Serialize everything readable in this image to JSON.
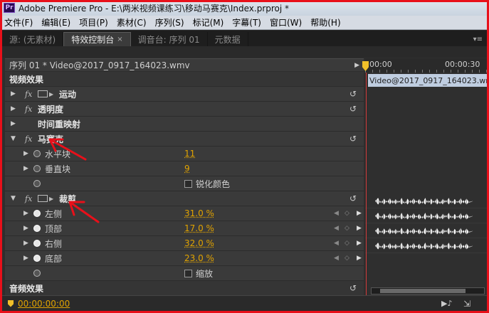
{
  "window": {
    "app_icon_label": "Pr",
    "title": "Adobe Premiere Pro - E:\\两米视频课练习\\移动马赛克\\Index.prproj *"
  },
  "menu": [
    "文件(F)",
    "编辑(E)",
    "项目(P)",
    "素材(C)",
    "序列(S)",
    "标记(M)",
    "字幕(T)",
    "窗口(W)",
    "帮助(H)"
  ],
  "tabs": [
    {
      "label": "源: (无素材)",
      "active": false
    },
    {
      "label": "特效控制台",
      "active": true,
      "close": "×"
    },
    {
      "label": "调音台: 序列 01",
      "active": false
    },
    {
      "label": "元数据",
      "active": false
    }
  ],
  "panel": {
    "sequence_label": "序列 01 * Video@2017_0917_164023.wmv",
    "timeline": {
      "start": "00:00",
      "end": "00:00:30",
      "clip_name": "Video@2017_0917_164023.wmv"
    },
    "video_effects_header": "视频效果",
    "effects": [
      {
        "name": "运动",
        "fx": "fx",
        "has_transform_icon": true
      },
      {
        "name": "透明度",
        "fx": "fx"
      },
      {
        "name": "时间重映射",
        "fx": ""
      },
      {
        "name": "马赛克",
        "fx": "fx",
        "expanded": true,
        "params": [
          {
            "name": "水平块",
            "value": "11"
          },
          {
            "name": "垂直块",
            "value": "9"
          },
          {
            "checkbox": "锐化颜色"
          }
        ]
      },
      {
        "name": "裁剪",
        "fx": "fx",
        "has_transform_icon": true,
        "expanded": true,
        "params": [
          {
            "name": "左侧",
            "value": "31.0 %"
          },
          {
            "name": "顶部",
            "value": "17.0 %"
          },
          {
            "name": "右侧",
            "value": "32.0 %"
          },
          {
            "name": "底部",
            "value": "23.0 %"
          },
          {
            "checkbox": "缩放"
          }
        ]
      }
    ],
    "audio_effects_header": "音频效果"
  },
  "status": {
    "timecode": "00:00:00:00"
  },
  "colors": {
    "annotation_red": "#e8101a",
    "value_orange": "#e1a300",
    "playhead_yellow": "#f0c02a"
  }
}
